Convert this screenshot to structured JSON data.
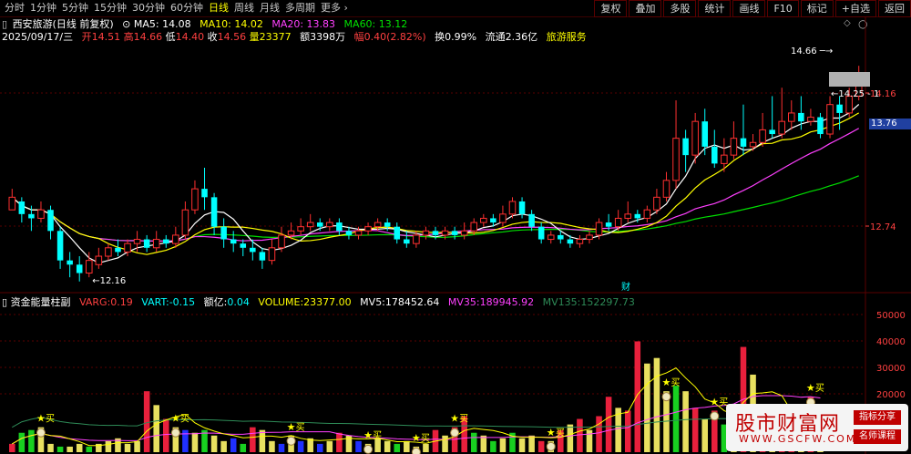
{
  "toolbar": {
    "periods": [
      "分时",
      "1分钟",
      "5分钟",
      "15分钟",
      "30分钟",
      "60分钟",
      "日线",
      "周线",
      "月线",
      "多周期",
      "更多"
    ],
    "active_period": "日线",
    "buttons": [
      "复权",
      "叠加",
      "多股",
      "统计",
      "画线",
      "F10",
      "标记",
      "+自选",
      "返回"
    ]
  },
  "info": {
    "stock_name": "西安旅游(日线 前复权)",
    "ma5_label": "MA5:",
    "ma5": "14.08",
    "ma10_label": "MA10:",
    "ma10": "14.02",
    "ma20_label": "MA20:",
    "ma20": "13.83",
    "ma60_label": "MA60:",
    "ma60": "13.12",
    "date": "2025/09/17/三",
    "open_label": "开",
    "open": "14.51",
    "high_label": "高",
    "high": "14.66",
    "low_label": "低",
    "low": "14.40",
    "close_label": "收",
    "close": "14.56",
    "vol_label": "量",
    "vol": "23377",
    "amount_label": "额",
    "amount": "3398万",
    "chg_label": "幅",
    "chg": "0.40(2.82%)",
    "turnover_label": "换",
    "turnover": "0.99%",
    "float_label": "流通",
    "float": "2.36亿",
    "sector": "旅游服务"
  },
  "indicator": {
    "name": "资金能量柱副",
    "varg_label": "VARG:",
    "varg": "0.19",
    "vart_label": "VART:",
    "vart": "-0.15",
    "eyi_label": "额亿:",
    "eyi": "0.04",
    "volume_label": "VOLUME:",
    "volume": "23377.00",
    "mv5_label": "MV5:",
    "mv5": "178452.64",
    "mv35_label": "MV35:",
    "mv35": "189945.92",
    "mv135_label": "MV135:",
    "mv135": "152297.73"
  },
  "price_axis": {
    "ticks": [
      "14.16",
      "12.74"
    ],
    "current": "13.76",
    "high_marker": "14.66",
    "low_marker": "12.16",
    "mid_marker": "14.25"
  },
  "volume_axis": {
    "ticks": [
      "50000",
      "40000",
      "30000",
      "20000"
    ]
  },
  "finance_marker": "财",
  "buy_label": "买",
  "watermark": {
    "title": "股市财富网",
    "url": "WWW.GSCFW.COM",
    "tag1": "指标分享",
    "tag2": "名师课程"
  },
  "colors": {
    "up": "#ff3030",
    "down": "#00ffff",
    "ma5": "#ffffff",
    "ma10": "#ffff00",
    "ma20": "#ff40ff",
    "ma60": "#00e000",
    "grid": "#5a0000",
    "vol_red": "#e8203c",
    "vol_yellow": "#e8e060",
    "vol_green": "#18d020",
    "vol_blue": "#2030ff"
  },
  "chart_data": {
    "type": "candlestick",
    "price_range": [
      12.0,
      14.9
    ],
    "candles": [
      [
        12.95,
        13.1,
        12.95,
        13.2
      ],
      [
        13.05,
        12.9,
        12.8,
        13.1
      ],
      [
        12.9,
        12.85,
        12.7,
        13.0
      ],
      [
        12.85,
        12.95,
        12.8,
        13.05
      ],
      [
        12.95,
        12.7,
        12.6,
        13.0
      ],
      [
        12.7,
        12.35,
        12.25,
        12.75
      ],
      [
        12.35,
        12.3,
        12.15,
        12.45
      ],
      [
        12.3,
        12.2,
        12.1,
        12.4
      ],
      [
        12.2,
        12.35,
        12.15,
        12.45
      ],
      [
        12.3,
        12.4,
        12.25,
        12.5
      ],
      [
        12.4,
        12.5,
        12.35,
        12.55
      ],
      [
        12.5,
        12.45,
        12.4,
        12.6
      ],
      [
        12.45,
        12.55,
        12.4,
        12.6
      ],
      [
        12.55,
        12.6,
        12.45,
        12.7
      ],
      [
        12.6,
        12.5,
        12.45,
        12.65
      ],
      [
        12.5,
        12.6,
        12.45,
        12.7
      ],
      [
        12.6,
        12.55,
        12.5,
        12.65
      ],
      [
        12.55,
        12.65,
        12.5,
        12.75
      ],
      [
        12.65,
        12.95,
        12.6,
        13.05
      ],
      [
        12.95,
        13.2,
        12.9,
        13.3
      ],
      [
        13.2,
        13.1,
        12.95,
        13.45
      ],
      [
        13.1,
        12.75,
        12.65,
        13.15
      ],
      [
        12.75,
        12.6,
        12.5,
        12.85
      ],
      [
        12.6,
        12.55,
        12.45,
        12.7
      ],
      [
        12.55,
        12.5,
        12.4,
        12.6
      ],
      [
        12.5,
        12.45,
        12.35,
        12.6
      ],
      [
        12.45,
        12.35,
        12.25,
        12.5
      ],
      [
        12.35,
        12.5,
        12.3,
        12.6
      ],
      [
        12.5,
        12.65,
        12.45,
        12.75
      ],
      [
        12.65,
        12.7,
        12.6,
        12.8
      ],
      [
        12.7,
        12.75,
        12.65,
        12.85
      ],
      [
        12.75,
        12.8,
        12.7,
        12.9
      ],
      [
        12.8,
        12.75,
        12.7,
        12.85
      ],
      [
        12.75,
        12.8,
        12.7,
        12.85
      ],
      [
        12.8,
        12.7,
        12.65,
        12.85
      ],
      [
        12.7,
        12.65,
        12.6,
        12.75
      ],
      [
        12.65,
        12.7,
        12.6,
        12.75
      ],
      [
        12.7,
        12.75,
        12.65,
        12.8
      ],
      [
        12.75,
        12.8,
        12.7,
        12.85
      ],
      [
        12.8,
        12.75,
        12.7,
        12.85
      ],
      [
        12.75,
        12.6,
        12.55,
        12.8
      ],
      [
        12.6,
        12.55,
        12.5,
        12.7
      ],
      [
        12.55,
        12.65,
        12.5,
        12.7
      ],
      [
        12.65,
        12.7,
        12.6,
        12.75
      ],
      [
        12.7,
        12.65,
        12.6,
        12.75
      ],
      [
        12.65,
        12.7,
        12.6,
        12.75
      ],
      [
        12.7,
        12.65,
        12.6,
        12.75
      ],
      [
        12.65,
        12.7,
        12.6,
        12.8
      ],
      [
        12.7,
        12.8,
        12.65,
        12.85
      ],
      [
        12.8,
        12.85,
        12.75,
        12.9
      ],
      [
        12.85,
        12.8,
        12.75,
        12.9
      ],
      [
        12.8,
        12.9,
        12.75,
        13.0
      ],
      [
        12.9,
        13.05,
        12.85,
        13.1
      ],
      [
        13.05,
        12.9,
        12.85,
        13.1
      ],
      [
        12.9,
        12.75,
        12.7,
        12.95
      ],
      [
        12.75,
        12.6,
        12.55,
        12.8
      ],
      [
        12.6,
        12.65,
        12.55,
        12.7
      ],
      [
        12.65,
        12.6,
        12.55,
        12.7
      ],
      [
        12.6,
        12.55,
        12.5,
        12.65
      ],
      [
        12.55,
        12.6,
        12.5,
        12.65
      ],
      [
        12.6,
        12.65,
        12.55,
        12.7
      ],
      [
        12.65,
        12.8,
        12.6,
        12.85
      ],
      [
        12.8,
        12.75,
        12.7,
        12.9
      ],
      [
        12.75,
        12.85,
        12.7,
        12.95
      ],
      [
        12.85,
        12.9,
        12.8,
        13.05
      ],
      [
        12.9,
        12.85,
        12.8,
        12.95
      ],
      [
        12.85,
        12.95,
        12.8,
        13.0
      ],
      [
        12.95,
        13.1,
        12.9,
        13.2
      ],
      [
        13.1,
        13.3,
        13.05,
        13.4
      ],
      [
        13.3,
        13.8,
        13.2,
        14.25
      ],
      [
        13.8,
        13.6,
        13.4,
        13.9
      ],
      [
        13.6,
        14.0,
        13.5,
        14.1
      ],
      [
        14.0,
        13.7,
        13.6,
        14.15
      ],
      [
        13.7,
        13.5,
        13.45,
        13.9
      ],
      [
        13.5,
        13.6,
        13.4,
        13.8
      ],
      [
        13.6,
        13.8,
        13.55,
        14.0
      ],
      [
        13.8,
        13.7,
        13.6,
        14.2
      ],
      [
        13.7,
        13.75,
        13.65,
        13.85
      ],
      [
        13.75,
        13.9,
        13.7,
        14.1
      ],
      [
        13.9,
        13.85,
        13.8,
        14.3
      ],
      [
        13.85,
        14.0,
        13.8,
        14.4
      ],
      [
        14.0,
        14.1,
        13.9,
        14.25
      ],
      [
        14.1,
        14.0,
        13.9,
        14.3
      ],
      [
        14.0,
        14.05,
        13.95,
        14.15
      ],
      [
        14.05,
        13.85,
        13.8,
        14.1
      ],
      [
        13.85,
        14.2,
        13.8,
        14.3
      ],
      [
        14.2,
        14.1,
        13.9,
        14.3
      ],
      [
        14.1,
        14.3,
        14.05,
        14.4
      ],
      [
        14.3,
        14.56,
        14.25,
        14.66
      ]
    ],
    "volumes": [
      [
        3,
        "r"
      ],
      [
        7,
        "g"
      ],
      [
        8,
        "g"
      ],
      [
        9,
        "y"
      ],
      [
        3,
        "y"
      ],
      [
        2,
        "g"
      ],
      [
        2,
        "y"
      ],
      [
        3,
        "y"
      ],
      [
        2,
        "g"
      ],
      [
        3,
        "y"
      ],
      [
        4,
        "y"
      ],
      [
        5,
        "y"
      ],
      [
        3,
        "y"
      ],
      [
        4,
        "y"
      ],
      [
        22,
        "r"
      ],
      [
        17,
        "y"
      ],
      [
        12,
        "r"
      ],
      [
        9,
        "y"
      ],
      [
        8,
        "b"
      ],
      [
        7,
        "y"
      ],
      [
        8,
        "g"
      ],
      [
        6,
        "y"
      ],
      [
        4,
        "y"
      ],
      [
        5,
        "b"
      ],
      [
        3,
        "g"
      ],
      [
        9,
        "r"
      ],
      [
        8,
        "y"
      ],
      [
        4,
        "y"
      ],
      [
        3,
        "b"
      ],
      [
        6,
        "y"
      ],
      [
        4,
        "b"
      ],
      [
        5,
        "y"
      ],
      [
        3,
        "b"
      ],
      [
        4,
        "y"
      ],
      [
        7,
        "r"
      ],
      [
        6,
        "y"
      ],
      [
        4,
        "b"
      ],
      [
        3,
        "y"
      ],
      [
        5,
        "y"
      ],
      [
        4,
        "y"
      ],
      [
        3,
        "g"
      ],
      [
        4,
        "y"
      ],
      [
        2,
        "y"
      ],
      [
        3,
        "y"
      ],
      [
        8,
        "r"
      ],
      [
        6,
        "y"
      ],
      [
        9,
        "r"
      ],
      [
        13,
        "r"
      ],
      [
        7,
        "g"
      ],
      [
        6,
        "y"
      ],
      [
        4,
        "g"
      ],
      [
        5,
        "y"
      ],
      [
        7,
        "g"
      ],
      [
        5,
        "y"
      ],
      [
        6,
        "y"
      ],
      [
        4,
        "r"
      ],
      [
        4,
        "y"
      ],
      [
        8,
        "r"
      ],
      [
        10,
        "y"
      ],
      [
        12,
        "r"
      ],
      [
        8,
        "y"
      ],
      [
        13,
        "r"
      ],
      [
        20,
        "r"
      ],
      [
        16,
        "y"
      ],
      [
        15,
        "r"
      ],
      [
        40,
        "r"
      ],
      [
        32,
        "y"
      ],
      [
        34,
        "y"
      ],
      [
        22,
        "y"
      ],
      [
        24,
        "g"
      ],
      [
        22,
        "y"
      ],
      [
        16,
        "r"
      ],
      [
        12,
        "y"
      ],
      [
        15,
        "r"
      ],
      [
        10,
        "g"
      ],
      [
        15,
        "y"
      ],
      [
        38,
        "r"
      ],
      [
        28,
        "y"
      ],
      [
        16,
        "r"
      ],
      [
        12,
        "y"
      ],
      [
        8,
        "r"
      ],
      [
        10,
        "r"
      ],
      [
        12,
        "y"
      ],
      [
        20,
        "r"
      ],
      [
        6,
        "y"
      ]
    ],
    "buy_signals": [
      3,
      17,
      29,
      37,
      42,
      46,
      56,
      68,
      73,
      79,
      83
    ]
  }
}
